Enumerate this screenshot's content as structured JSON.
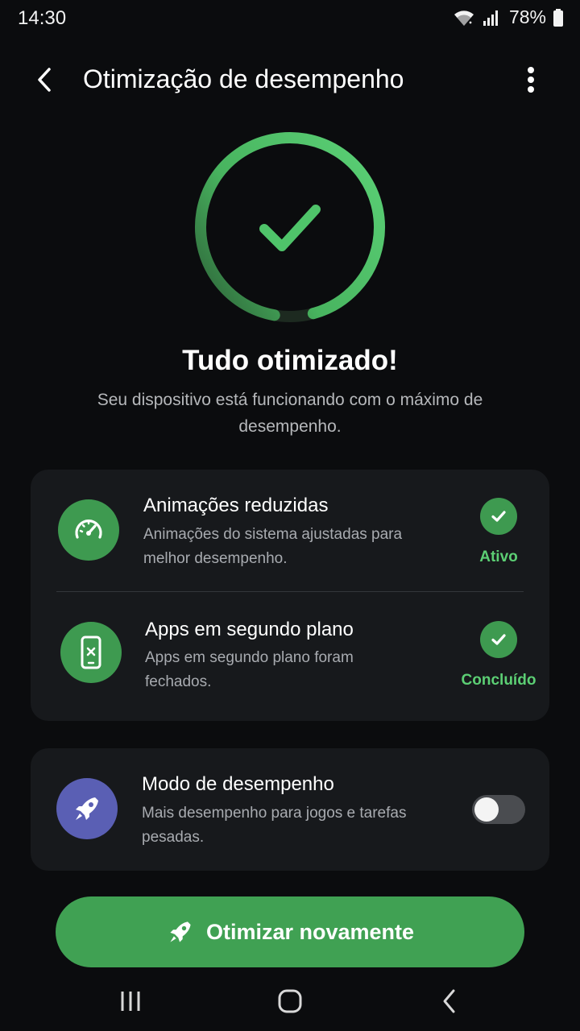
{
  "status_bar": {
    "time": "14:30",
    "battery": "78%",
    "icons": [
      "wifi-icon",
      "signal-icon",
      "battery-icon"
    ]
  },
  "app_bar": {
    "title": "Otimização de desempenho",
    "back_icon": "chevron-left-icon",
    "more_icon": "more-vertical-icon"
  },
  "hero": {
    "icon": "checkmark-icon",
    "progress_fraction": 0.93,
    "title": "Tudo otimizado!",
    "subtitle": "Seu dispositivo está funcionando com o máximo de desempenho."
  },
  "status_card": {
    "items": [
      {
        "icon": "speedometer-icon",
        "title": "Animações reduzidas",
        "description": "Animações do sistema ajustadas para melhor desempenho.",
        "status": "Ativo"
      },
      {
        "icon": "phone-close-icon",
        "title": "Apps em segundo plano",
        "description": "Apps em segundo plano foram fechados.",
        "status": "Concluído"
      }
    ]
  },
  "performance_mode": {
    "icon": "rocket-icon",
    "title": "Modo de desempenho",
    "description": "Mais desempenho para jogos e tarefas pesadas.",
    "enabled": false
  },
  "primary_button": {
    "icon": "rocket-icon",
    "label": "Otimizar novamente"
  },
  "nav_bar": {
    "items": [
      "recents-icon",
      "home-icon",
      "back-icon"
    ]
  },
  "colors": {
    "background": "#0b0c0e",
    "card": "#17191c",
    "accent_green": "#40a153",
    "status_green": "#5ccf74",
    "purple": "#5a5fb4"
  }
}
